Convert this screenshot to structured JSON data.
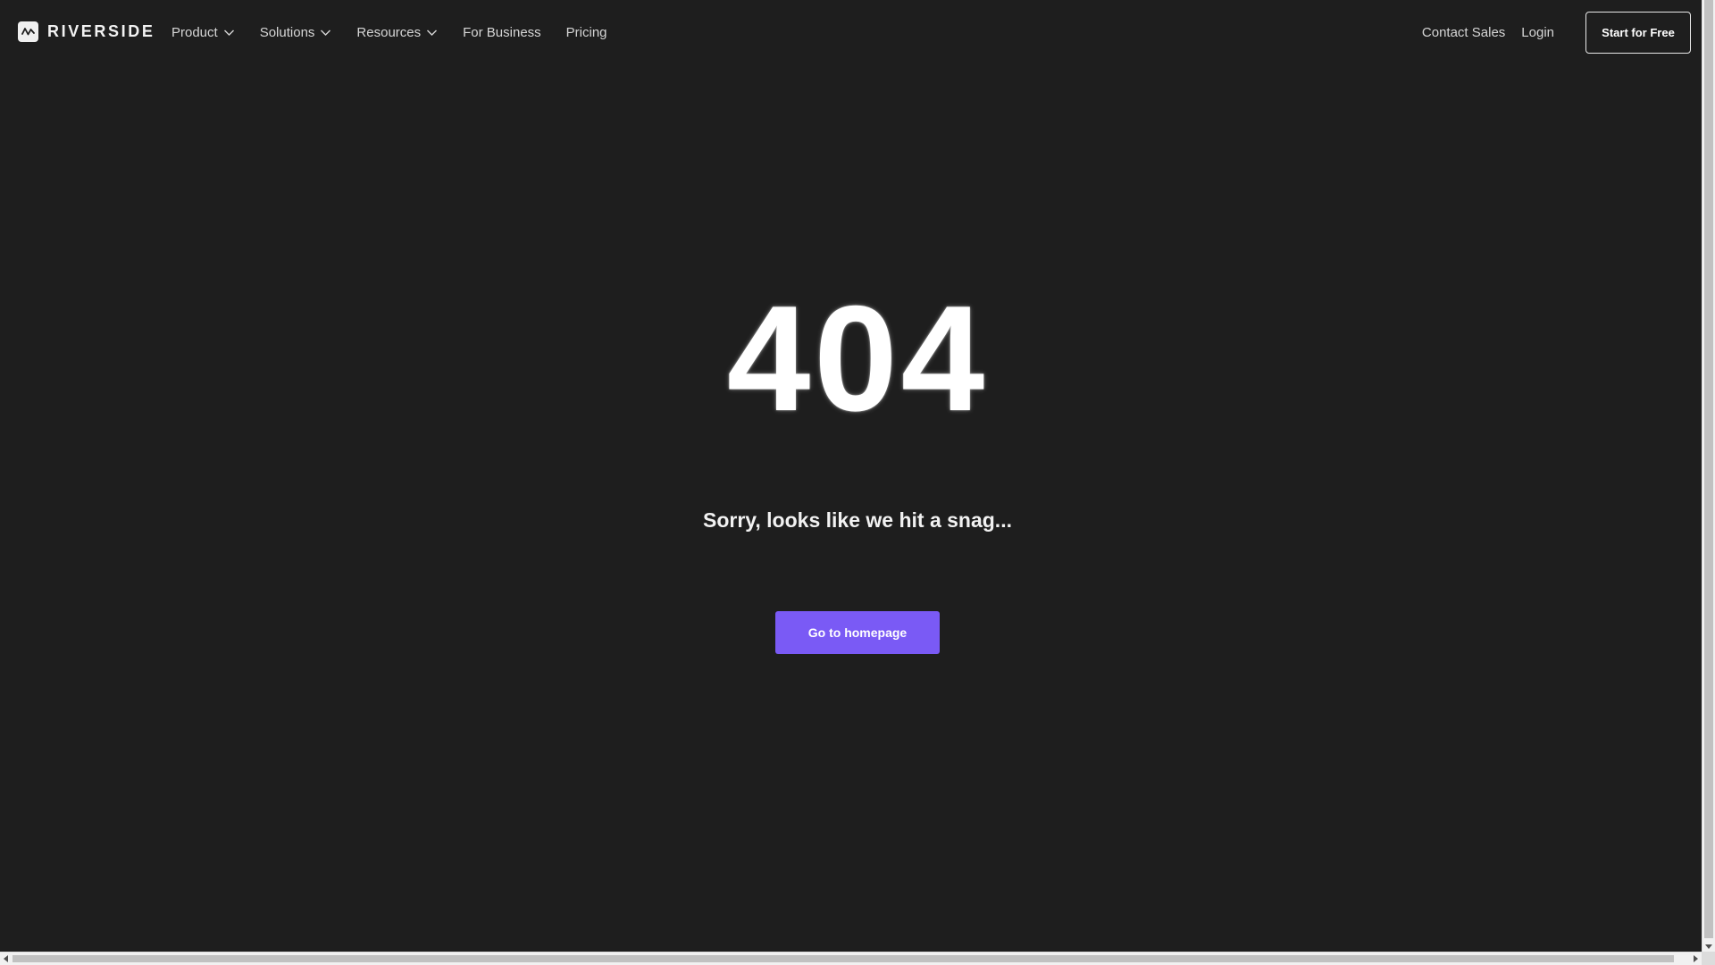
{
  "brand": {
    "name": "RIVERSIDE",
    "logo_icon": "riverside-wave-icon"
  },
  "nav": {
    "items": [
      {
        "label": "Product",
        "has_dropdown": true
      },
      {
        "label": "Solutions",
        "has_dropdown": true
      },
      {
        "label": "Resources",
        "has_dropdown": true
      },
      {
        "label": "For Business",
        "has_dropdown": false
      },
      {
        "label": "Pricing",
        "has_dropdown": false
      }
    ],
    "contact_sales": "Contact Sales",
    "login": "Login",
    "cta": "Start for Free"
  },
  "error": {
    "code": "404",
    "message": "Sorry, looks like we hit a snag...",
    "button": "Go to homepage"
  },
  "colors": {
    "background": "#1e1e1e",
    "accent": "#7a5af5",
    "text": "#f2f2f2"
  }
}
